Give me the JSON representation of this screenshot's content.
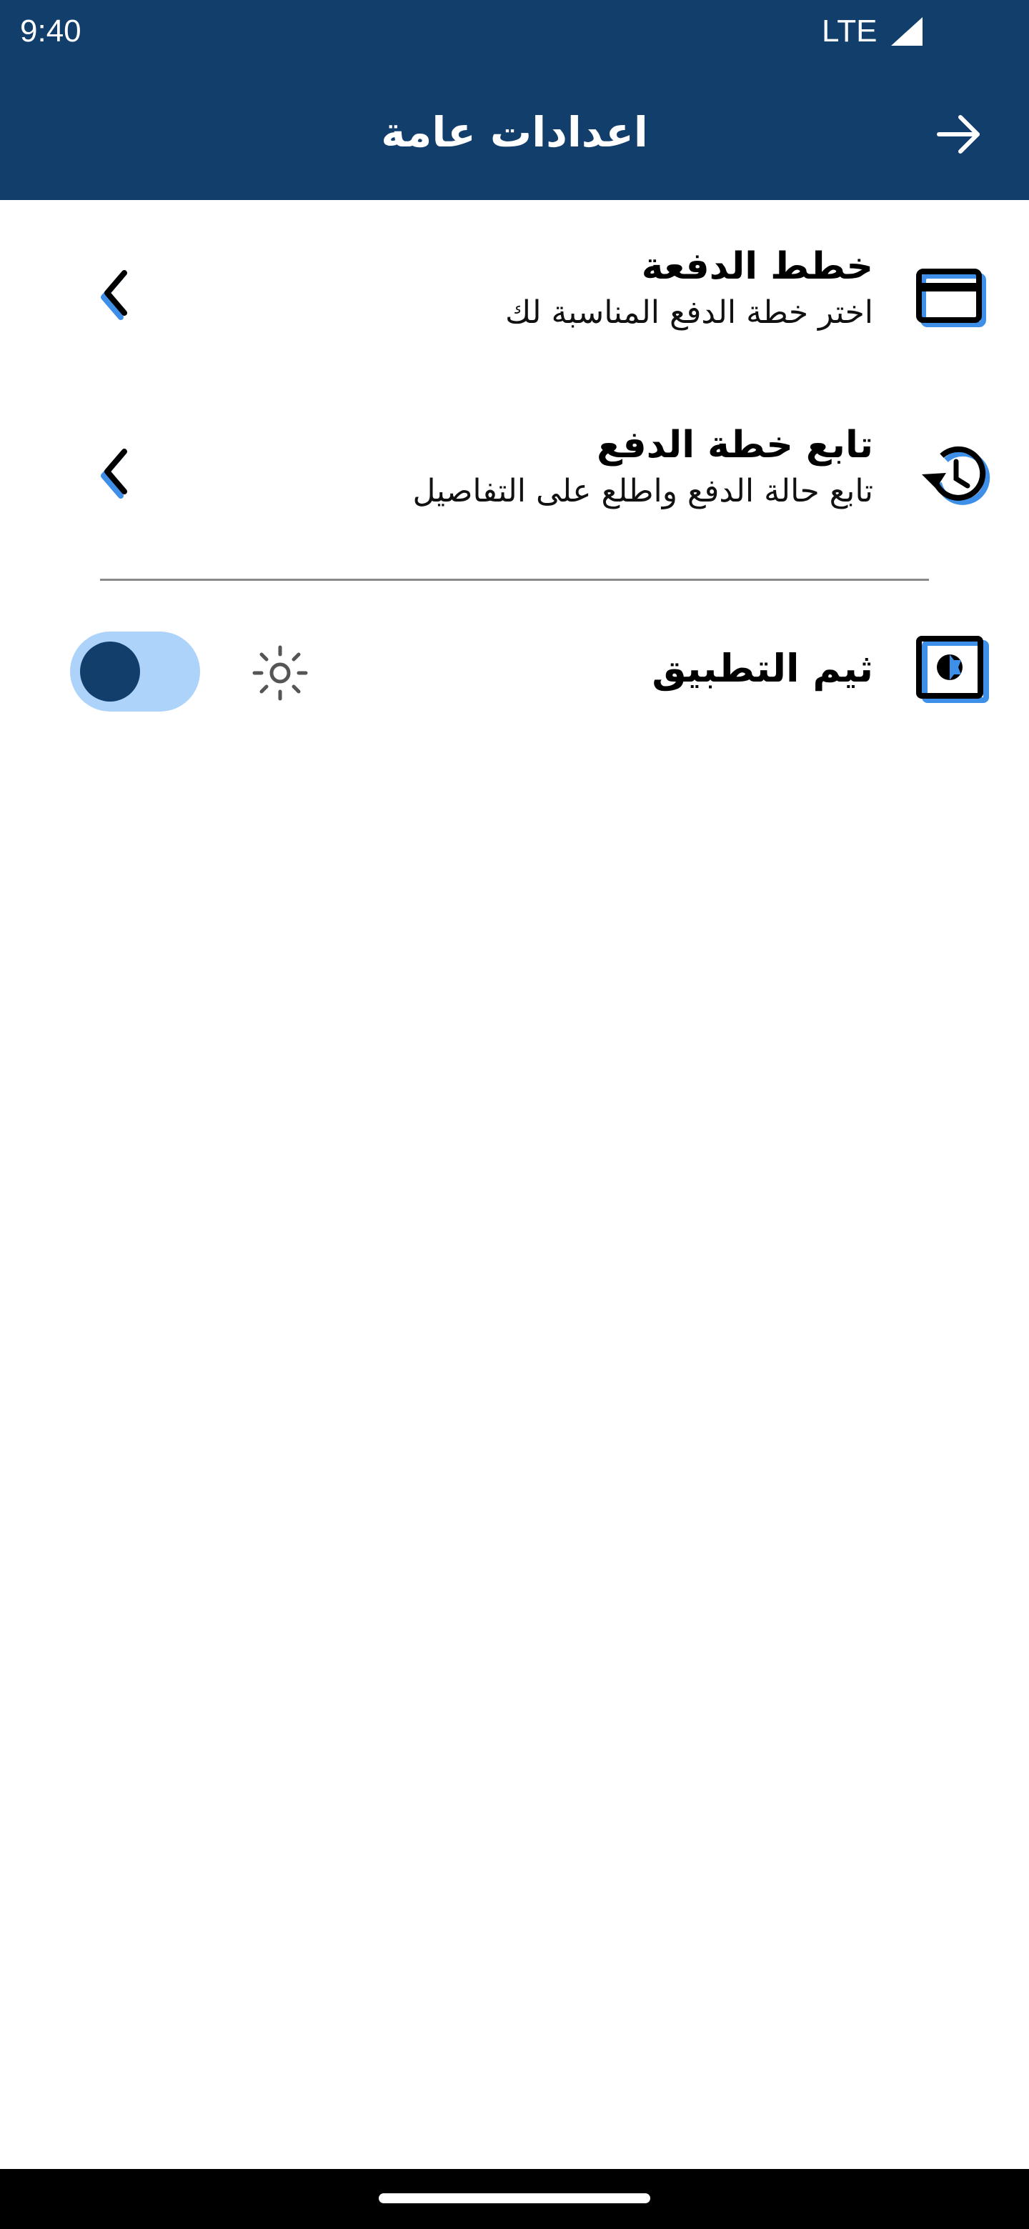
{
  "status_bar": {
    "time": "9:40",
    "network": "LTE"
  },
  "header": {
    "title": "اعدادات عامة",
    "back_icon": "arrow-right-icon",
    "background": "#123e6c"
  },
  "settings": {
    "items": [
      {
        "title": "خطط الدفعة",
        "subtitle": "اختر خطة الدفع المناسبة لك",
        "icon": "credit-card-icon"
      },
      {
        "title": "تابع خطة الدفع",
        "subtitle": "تابع حالة الدفع واطلع على التفاصيل",
        "icon": "history-icon"
      }
    ],
    "theme": {
      "label": "ثيم التطبيق",
      "icon": "brightness-icon",
      "state_icon": "sun-icon",
      "toggle_on": false
    }
  },
  "colors": {
    "primary": "#123e6c",
    "accent": "#3d8fe8",
    "toggle_track": "#aed3fb"
  }
}
